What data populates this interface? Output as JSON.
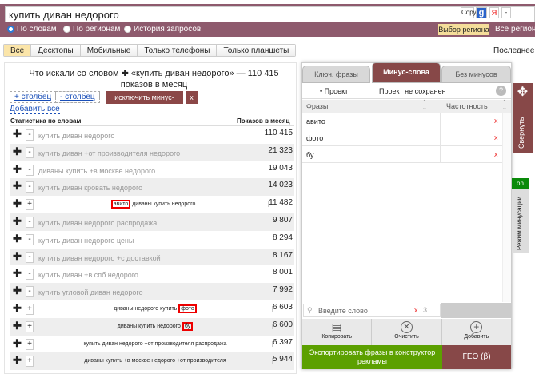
{
  "search": {
    "query": "купить диван недорого",
    "copy": "Copy",
    "g": "g",
    "ya": "Я",
    "dash": "-"
  },
  "modes": [
    "По словам",
    "По регионам",
    "История запросов"
  ],
  "region_button": "Выбор региона",
  "all_regions": "Все регионы",
  "device_tabs": [
    "Все",
    "Десктопы",
    "Мобильные",
    "Только телефоны",
    "Только планшеты"
  ],
  "last_updated": "Последнее о",
  "left": {
    "title": "Что искали со словом ✚ «купить диван недорого» — 110 415 показов в месяц",
    "add_col": "+ столбец",
    "remove_col": "- столбец",
    "exclude": "исключить минус-слова",
    "x": "x",
    "add_all": "Добавить все",
    "col_stats": "Статистика по словам",
    "col_shows": "Показов в месяц",
    "rows": [
      {
        "pre": "",
        "hl": "",
        "post": "купить диван недорого",
        "count": "110 415",
        "added": false
      },
      {
        "pre": "",
        "hl": "",
        "post": "купить диван +от производителя недорого",
        "count": "21 323",
        "added": false
      },
      {
        "pre": "",
        "hl": "",
        "post": "диваны купить +в москве недорого",
        "count": "19 043",
        "added": false
      },
      {
        "pre": "",
        "hl": "",
        "post": "купить диван кровать недорого",
        "count": "14 023",
        "added": false
      },
      {
        "pre": "",
        "hl": "авито",
        "post": " диваны купить недорого",
        "count": "11 482",
        "added": true
      },
      {
        "pre": "",
        "hl": "",
        "post": "купить диван недорого распродажа",
        "count": "9 807",
        "added": false
      },
      {
        "pre": "",
        "hl": "",
        "post": "купить диван недорого цены",
        "count": "8 294",
        "added": false
      },
      {
        "pre": "",
        "hl": "",
        "post": "купить диван недорого +с доставкой",
        "count": "8 167",
        "added": false
      },
      {
        "pre": "",
        "hl": "",
        "post": "купить диван +в спб недорого",
        "count": "8 001",
        "added": false
      },
      {
        "pre": "",
        "hl": "",
        "post": "купить угловой диван недорого",
        "count": "7 992",
        "added": false
      },
      {
        "pre": "диваны недорого купить ",
        "hl": "фото",
        "post": "",
        "count": "6 603",
        "added": true
      },
      {
        "pre": "диваны купить недорого ",
        "hl": "бу",
        "post": "",
        "count": "6 600",
        "added": true
      },
      {
        "pre": "",
        "hl": "",
        "post": "купить диван недорого +от производителя распродажа",
        "count": "6 397",
        "added": true
      },
      {
        "pre": "",
        "hl": "",
        "post": "диваны купить +в москве недорого +от производителя",
        "count": "5 944",
        "added": true
      }
    ]
  },
  "panel": {
    "tabs": [
      "Ключ. фразы",
      "Минус-слова",
      "Без минусов"
    ],
    "project": "• Проект",
    "project_status": "Проект не сохранен",
    "help": "?",
    "col_phrases": "Фразы",
    "col_freq": "Частотность",
    "words": [
      "авито",
      "фото",
      "бу"
    ],
    "search_placeholder": "Введите слово",
    "count": "3",
    "copy": "Копировать",
    "clear": "Очистить",
    "add": "Добавить",
    "export": "Экспортировать фразы в конструктор рекламы",
    "geo": "ГЕО (β)",
    "collapse": "Свернуть",
    "toggle": "on",
    "mode": "Режим минусации"
  }
}
